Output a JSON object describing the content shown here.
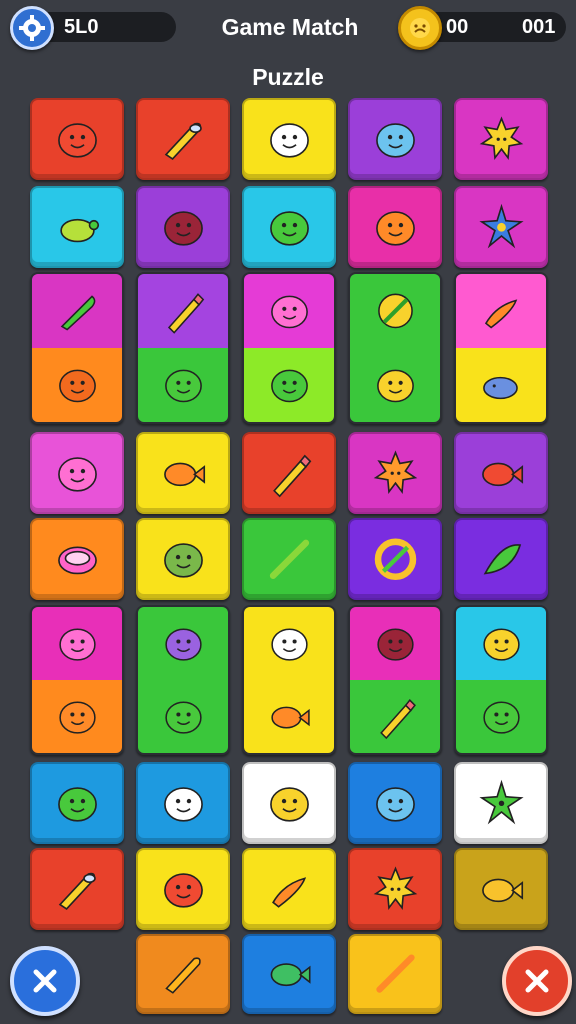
{
  "header": {
    "title": "Game Match",
    "subtitle": "Puzzle",
    "score": "5L0",
    "coins": "00",
    "moves": "001"
  },
  "icons": {
    "settings": "gear-icon",
    "coin": "coin-icon",
    "close_left": "close-icon",
    "close_right": "cancel-icon"
  },
  "colors": {
    "background": "#3a3d44",
    "pill": "#1c1e22"
  },
  "board": {
    "tiles": [
      {
        "bg": "#e8412b",
        "item": "red-blob"
      },
      {
        "bg": "#e8412b",
        "item": "rocket"
      },
      {
        "bg": "#f9e21b",
        "item": "white-blob"
      },
      {
        "bg": "#9b3fd9",
        "item": "blue-blob"
      },
      {
        "bg": "#d936c3",
        "item": "sun"
      },
      {
        "bg": "#29c7e8",
        "item": "turtle"
      },
      {
        "bg": "#9b3fd9",
        "item": "maroon-blob"
      },
      {
        "bg": "#29c7e8",
        "item": "green-blob"
      },
      {
        "bg": "#e82fa8",
        "item": "orange-blob"
      },
      {
        "bg": "#d936c3",
        "item": "blue-star"
      },
      {
        "bg": "#d936c3",
        "item": "feather"
      },
      {
        "bg": "#a444e0",
        "item": "pencil"
      },
      {
        "bg": "#e53bd6",
        "item": "pink-blob"
      },
      {
        "bg": "#ff8a1e",
        "item": "orange-pumpkin"
      },
      {
        "bg": "#ff8a1e",
        "item": "orange-blob"
      },
      {
        "bg": "#3ac73b",
        "item": "green-blob"
      },
      {
        "bg": "#8dea28",
        "item": "green-blob"
      },
      {
        "bg": "#3ac73b",
        "item": "yellow-ball"
      },
      {
        "bg": "#3ac73b",
        "item": "yellow-blob"
      },
      {
        "bg": "#ff5ad0",
        "item": "carrot"
      },
      {
        "bg": "#f9e21b",
        "item": "blue-fish"
      },
      {
        "bg": "#e853d8",
        "item": "pink-blob"
      },
      {
        "bg": "#f9e21b",
        "item": "orange-fish"
      },
      {
        "bg": "#e8412b",
        "item": "pencil"
      },
      {
        "bg": "#d936c3",
        "item": "orange-sun"
      },
      {
        "bg": "#9b3fd9",
        "item": "red-fish"
      },
      {
        "bg": "#ff8a1e",
        "item": "pink-ring"
      },
      {
        "bg": "#f9e21b",
        "item": "green-face"
      },
      {
        "bg": "#3ac73b",
        "item": "green-stick"
      },
      {
        "bg": "#7a2de0",
        "item": "yellow-ring"
      },
      {
        "bg": "#7a2de0",
        "item": "green-leaf"
      },
      {
        "bg": "#e82fb8",
        "item": "pink-blob"
      },
      {
        "bg": "#ff8a1e",
        "item": "orange-blob"
      },
      {
        "bg": "#3ac73b",
        "item": "purple-blob"
      },
      {
        "bg": "#3ac73b",
        "item": "green-blob"
      },
      {
        "bg": "#f9e21b",
        "item": "white-blob"
      },
      {
        "bg": "#f9e21b",
        "item": "orange-fish"
      },
      {
        "bg": "#e82fb8",
        "item": "maroon-blob"
      },
      {
        "bg": "#3ac73b",
        "item": "pencil"
      },
      {
        "bg": "#29c7e8",
        "item": "yellow-blob"
      },
      {
        "bg": "#3ac73b",
        "item": "green-blob"
      },
      {
        "bg": "#1e9ae0",
        "item": "green-blob"
      },
      {
        "bg": "#1e9ae0",
        "item": "white-blob"
      },
      {
        "bg": "#ffffff",
        "item": "yellow-blob"
      },
      {
        "bg": "#1e7fe0",
        "item": "blue-blob"
      },
      {
        "bg": "#ffffff",
        "item": "green-star"
      },
      {
        "bg": "#e8412b",
        "item": "rocket"
      },
      {
        "bg": "#f9e21b",
        "item": "red-blob"
      },
      {
        "bg": "#f9e21b",
        "item": "carrot"
      },
      {
        "bg": "#e8412b",
        "item": "yellow-sun"
      },
      {
        "bg": "#c9a31b",
        "item": "yellow-fish"
      },
      {
        "bg": "#f08a1e",
        "item": "comet"
      },
      {
        "bg": "#1e7fe0",
        "item": "green-fish"
      },
      {
        "bg": "#f9c21b",
        "item": "orange-stick"
      }
    ]
  }
}
